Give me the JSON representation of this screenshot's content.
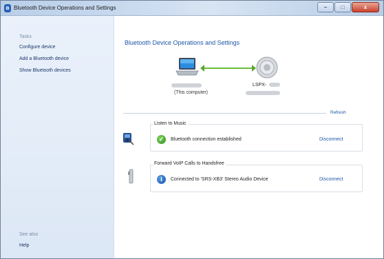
{
  "window": {
    "title": "Bluetooth Device Operations and Settings",
    "controls": {
      "minimize": "–",
      "maximize": "□",
      "close": "x"
    }
  },
  "sidebar": {
    "tasks_heading": "Tasks",
    "items": [
      {
        "label": "Configure device"
      },
      {
        "label": "Add a Bluetooth device"
      },
      {
        "label": "Show Bluetooth devices"
      }
    ],
    "see_also_heading": "See also",
    "help_label": "Help"
  },
  "main": {
    "title": "Bluetooth Device Operations and Settings",
    "computer_caption": "(This computer)",
    "device_name": "LSPX-",
    "refresh_label": "Refresh",
    "services": [
      {
        "legend": "Listen to Music",
        "status": "Bluetooth connection established",
        "status_icon": "check-icon",
        "action": "Disconnect"
      },
      {
        "legend": "Forward VoIP Calls to Handsfree",
        "status": "Connected to 'SRS-XB3' Stereo Audio Device",
        "status_icon": "info-icon",
        "action": "Disconnect"
      }
    ]
  },
  "colors": {
    "link": "#1d56a6",
    "ok_green": "#2f8d1d",
    "info_blue": "#1650a6",
    "connection_line": "#6bbd3d"
  }
}
